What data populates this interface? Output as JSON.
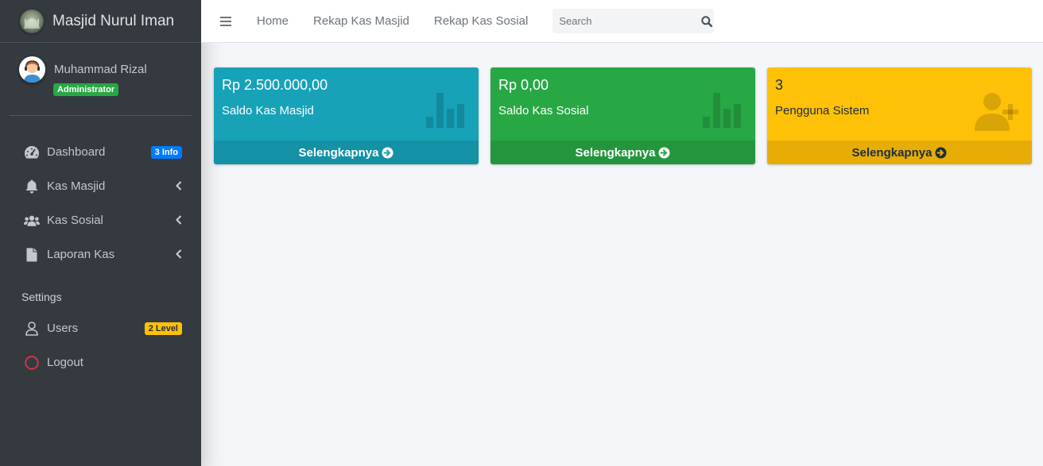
{
  "brand": {
    "title": "Masjid Nurul Iman",
    "logo_icon": "mosque-logo-icon"
  },
  "user": {
    "name": "Muhammad Rizal",
    "role_badge": "Administrator"
  },
  "sidebar": {
    "items": [
      {
        "label": "Dashboard",
        "icon": "tachometer-icon",
        "badge": "3 Info"
      },
      {
        "label": "Kas Masjid",
        "icon": "bell-icon"
      },
      {
        "label": "Kas Sosial",
        "icon": "users-icon"
      },
      {
        "label": "Laporan Kas",
        "icon": "file-icon"
      }
    ],
    "settings_header": "Settings",
    "settings_items": [
      {
        "label": "Users",
        "icon": "user-icon",
        "badge": "2 Level"
      },
      {
        "label": "Logout",
        "icon": "circle-icon"
      }
    ]
  },
  "topbar": {
    "links": [
      "Home",
      "Rekap Kas Masjid",
      "Rekap Kas Sosial"
    ],
    "search_placeholder": "Search"
  },
  "boxes": [
    {
      "value": "Rp 2.500.000,00",
      "label": "Saldo Kas Masjid",
      "footer": "Selengkapnya",
      "color": "#17a2b8",
      "icon": "bar-chart-icon"
    },
    {
      "value": "Rp 0,00",
      "label": "Saldo Kas Sosial",
      "footer": "Selengkapnya",
      "color": "#28a745",
      "icon": "bar-chart-icon"
    },
    {
      "value": "3",
      "label": "Pengguna Sistem",
      "footer": "Selengkapnya",
      "color": "#ffc107",
      "icon": "user-plus-icon"
    }
  ]
}
